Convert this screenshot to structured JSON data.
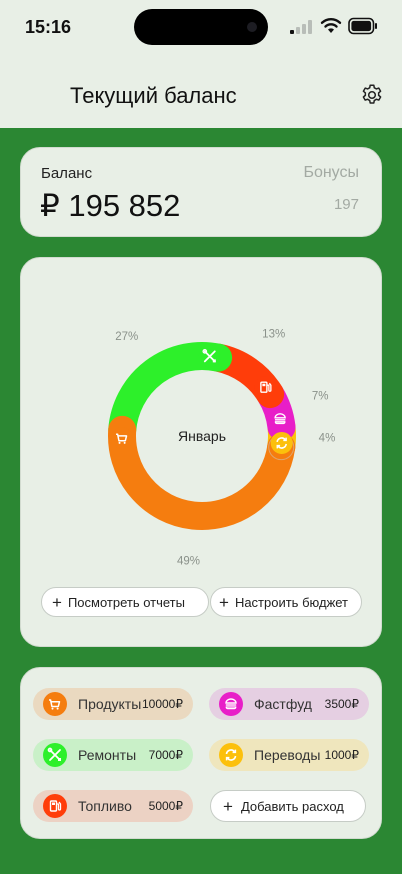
{
  "status_bar": {
    "time": "15:16"
  },
  "header": {
    "title": "Текущий баланс",
    "settings_icon": "gear-icon"
  },
  "balance_card": {
    "balance_label": "Баланс",
    "balance_value": "₽ 195 852",
    "bonus_label": "Бонусы",
    "bonus_value": "197"
  },
  "chart_card": {
    "center_label": "Январь",
    "reports_button": "Посмотреть отчеты",
    "budget_button": "Настроить бюджет"
  },
  "chart_data": {
    "type": "pie",
    "center_label": "Январь",
    "slices": [
      {
        "name": "Продукты",
        "percent_label": "49%",
        "value": 49,
        "color": "#f57d0f",
        "icon": "cart-icon"
      },
      {
        "name": "Ремонты",
        "percent_label": "27%",
        "value": 27,
        "color": "#2df02a",
        "icon": "tools-icon"
      },
      {
        "name": "Топливо",
        "percent_label": "13%",
        "value": 13,
        "color": "#ff3d0a",
        "icon": "fuel-icon"
      },
      {
        "name": "Фастфуд",
        "percent_label": "7%",
        "value": 7,
        "color": "#e81ec8",
        "icon": "burger-icon"
      },
      {
        "name": "Переводы",
        "percent_label": "4%",
        "value": 4,
        "color": "#fcc00c",
        "icon": "transfer-icon"
      }
    ]
  },
  "expenses": {
    "items": [
      {
        "name": "Продукты",
        "amount": "10000₽",
        "color": "#f57d0f",
        "bg": "#ead9c0",
        "icon": "cart-icon"
      },
      {
        "name": "Фастфуд",
        "amount": "3500₽",
        "color": "#e81ec8",
        "bg": "#e5cfe2",
        "icon": "burger-icon"
      },
      {
        "name": "Ремонты",
        "amount": "7000₽",
        "color": "#2df02a",
        "bg": "#c9f0c8",
        "icon": "tools-icon"
      },
      {
        "name": "Переводы",
        "amount": "1000₽",
        "color": "#fcc00c",
        "bg": "#efe6bd",
        "icon": "transfer-icon"
      },
      {
        "name": "Топливо",
        "amount": "5000₽",
        "color": "#ff3d0a",
        "bg": "#ecd2c4",
        "icon": "fuel-icon"
      }
    ],
    "add_button": "Добавить расход"
  }
}
